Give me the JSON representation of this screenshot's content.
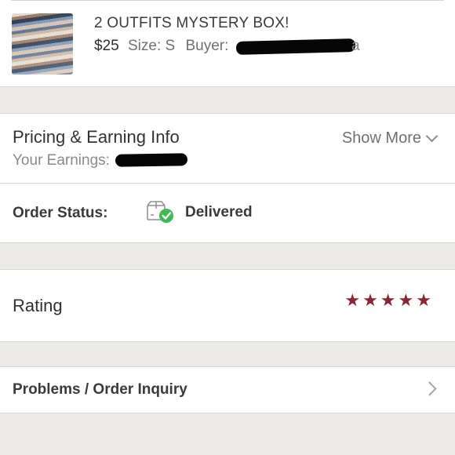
{
  "order_item": {
    "title": "2 OUTFITS MYSTERY BOX!",
    "price": "$25",
    "size_label": "Size:",
    "size_value": "S",
    "buyer_label": "Buyer:",
    "buyer_visible_tail": "a"
  },
  "pricing": {
    "title": "Pricing & Earning Info",
    "earnings_label": "Your Earnings:",
    "show_more_label": "Show More"
  },
  "order_status": {
    "label": "Order Status:",
    "value": "Delivered",
    "icon": "delivered-box-icon",
    "check_color": "#3cba54"
  },
  "rating": {
    "label": "Rating",
    "stars": 5,
    "star_color": "#8a2432"
  },
  "problems": {
    "label": "Problems / Order Inquiry"
  }
}
